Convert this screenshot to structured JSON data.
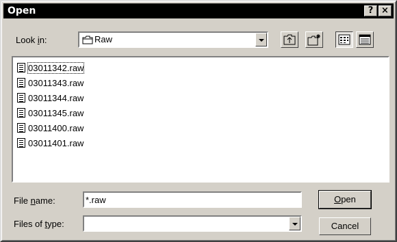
{
  "window": {
    "title": "Open",
    "help_label": "?",
    "close_label": "×"
  },
  "lookin": {
    "label_pre": "Look ",
    "label_ul": "i",
    "label_post": "n:",
    "value": "Raw",
    "icon": "folder-icon"
  },
  "toolbar": {
    "up_icon": "up-one-level-icon",
    "new_folder_icon": "new-folder-icon",
    "list_icon": "list-view-icon",
    "details_icon": "details-view-icon"
  },
  "files": [
    {
      "name": "03011342.raw"
    },
    {
      "name": "03011343.raw"
    },
    {
      "name": "03011344.raw"
    },
    {
      "name": "03011345.raw"
    },
    {
      "name": "03011400.raw"
    },
    {
      "name": "03011401.raw"
    }
  ],
  "filename": {
    "label_pre": "File ",
    "label_ul": "n",
    "label_post": "ame:",
    "value": "*.raw"
  },
  "filetype": {
    "label_pre": "Files of ",
    "label_ul": "t",
    "label_post": "ype:",
    "value": ""
  },
  "buttons": {
    "open_ul": "O",
    "open_rest": "pen",
    "cancel": "Cancel"
  }
}
